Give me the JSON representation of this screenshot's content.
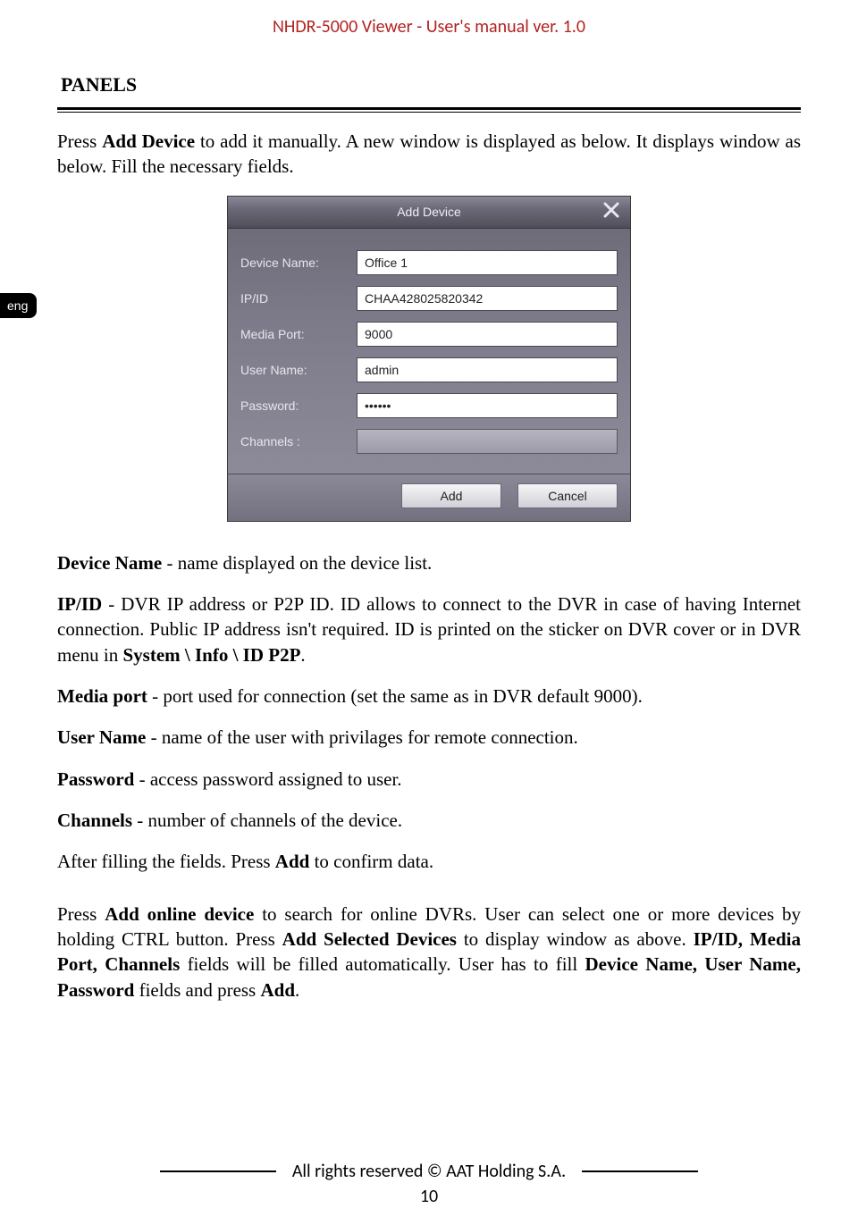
{
  "header": {
    "title": "NHDR-5000 Viewer - User's manual ver. 1.0"
  },
  "sidebar": {
    "lang": "eng"
  },
  "section": {
    "title": "PANELS"
  },
  "intro": {
    "pre": "Press ",
    "bold1": "Add Device ",
    "post": "to add it manually. A new window is displayed as below. It displays window as below. Fill the necessary fields."
  },
  "dialog": {
    "title": "Add Device",
    "labels": {
      "device_name": "Device Name:",
      "ip_id": "IP/ID",
      "media_port": "Media Port:",
      "user_name": "User Name:",
      "password": "Password:",
      "channels": "Channels :"
    },
    "values": {
      "device_name": "Office 1",
      "ip_id": "CHAA428025820342",
      "media_port": "9000",
      "user_name": "admin",
      "password": "••••••",
      "channels": ""
    },
    "buttons": {
      "add": "Add",
      "cancel": "Cancel"
    }
  },
  "desc": {
    "device_name_b": "Device Name ",
    "device_name_t": "- name displayed on the device list.",
    "ipid_line_b1": "IP/ID ",
    "ipid_line_t1": "- DVR IP address or P2P ID. ID allows to connect to the DVR in case of having Internet connection. Public IP address isn't required. ID is printed on the sticker on DVR cover or in DVR menu in ",
    "ipid_line_b2": "System \\ Info \\ ID P2P",
    "ipid_line_t2": ".",
    "media_b": "Media port ",
    "media_t": "- port used for connection (set the same as in DVR default 9000).",
    "user_b": "User Name ",
    "user_t": "- name of the user with privilages for remote connection.",
    "pass_b": "Password ",
    "pass_t": "- access password assigned to user.",
    "chan_b": "Channels ",
    "chan_t": "- number of channels of the device.",
    "after_pre": "After filling the fields. Press ",
    "after_b": "Add ",
    "after_post": "to confirm data."
  },
  "para2": {
    "t1": "Press ",
    "b1": "Add online device ",
    "t2": "to search for online DVRs. User can select one or more devices by holding CTRL button. Press ",
    "b2": "Add Selected Devices ",
    "t3": "to display window as above. ",
    "b3": "IP/ID, Media Port, Channels ",
    "t4": "fields will be filled automatically. User has to fill ",
    "b4": "Device Name, User Name, Password ",
    "t5": "fields and press ",
    "b5": "Add",
    "t6": "."
  },
  "footer": {
    "copyright": "All rights reserved © AAT Holding S.A.",
    "page": "10"
  }
}
